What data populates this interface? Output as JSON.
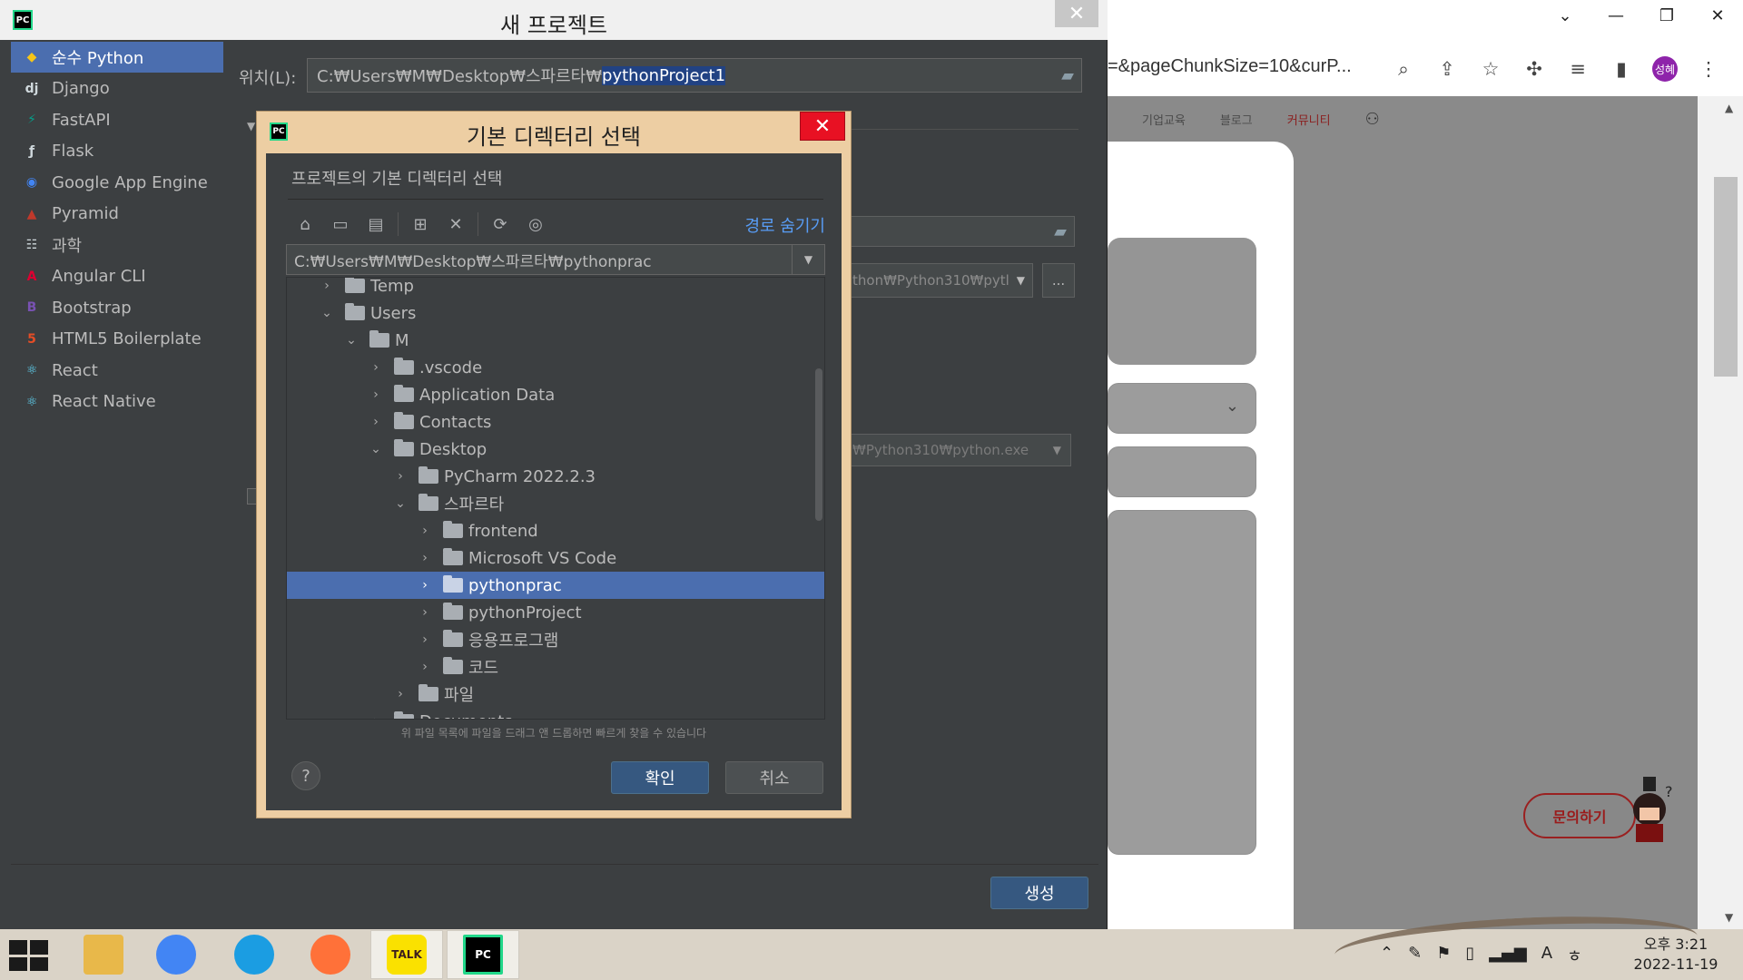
{
  "pycharm": {
    "title": "새 프로젝트",
    "close": "✕",
    "sidebar": [
      {
        "label": "순수 Python",
        "icon": "python-icon",
        "glyph": "◆",
        "color": "#f5c518",
        "selected": true
      },
      {
        "label": "Django",
        "icon": "django-icon",
        "glyph": "dj",
        "color": "#cfd8dc",
        "selected": false
      },
      {
        "label": "FastAPI",
        "icon": "fastapi-icon",
        "glyph": "⚡",
        "color": "#059f8a",
        "selected": false
      },
      {
        "label": "Flask",
        "icon": "flask-icon",
        "glyph": "ƒ",
        "color": "#cfd8dc",
        "selected": false
      },
      {
        "label": "Google App Engine",
        "icon": "google-app-engine-icon",
        "glyph": "◉",
        "color": "#4285f4",
        "selected": false
      },
      {
        "label": "Pyramid",
        "icon": "pyramid-icon",
        "glyph": "▲",
        "color": "#c0392b",
        "selected": false
      },
      {
        "label": "과학",
        "icon": "science-grid-icon",
        "glyph": "☷",
        "color": "#cfd8dc",
        "selected": false
      },
      {
        "label": "Angular CLI",
        "icon": "angular-icon",
        "glyph": "A",
        "color": "#dd0031",
        "selected": false
      },
      {
        "label": "Bootstrap",
        "icon": "bootstrap-icon",
        "glyph": "B",
        "color": "#7952b3",
        "selected": false
      },
      {
        "label": "HTML5 Boilerplate",
        "icon": "html5-icon",
        "glyph": "5",
        "color": "#e44d26",
        "selected": false
      },
      {
        "label": "React",
        "icon": "react-icon",
        "glyph": "⚛",
        "color": "#61dafb",
        "selected": false
      },
      {
        "label": "React Native",
        "icon": "react-native-icon",
        "glyph": "⚛",
        "color": "#61dafb",
        "selected": false
      }
    ],
    "location_label": "위치(L):",
    "location_prefix": "C:₩Users₩M₩Desktop₩스파르타₩",
    "location_selected": "pythonProject1",
    "interpreter_partial": "thon₩Python310₩pytl",
    "base_interpreter_partial": "₩Python310₩python.exe",
    "more_button": "...",
    "create_button": "생성"
  },
  "dialog": {
    "title": "기본 디렉터리 선택",
    "close": "✕",
    "subtitle": "프로젝트의 기본 디렉터리 선택",
    "hide_path": "경로 숨기기",
    "path": "C:₩Users₩M₩Desktop₩스파르타₩pythonprac",
    "tree": [
      {
        "label": "Temp",
        "depth": 0,
        "expanded": false,
        "selected": false
      },
      {
        "label": "Users",
        "depth": 0,
        "expanded": true,
        "selected": false
      },
      {
        "label": "M",
        "depth": 1,
        "expanded": true,
        "selected": false
      },
      {
        "label": ".vscode",
        "depth": 2,
        "expanded": false,
        "selected": false
      },
      {
        "label": "Application Data",
        "depth": 2,
        "expanded": false,
        "selected": false
      },
      {
        "label": "Contacts",
        "depth": 2,
        "expanded": false,
        "selected": false
      },
      {
        "label": "Desktop",
        "depth": 2,
        "expanded": true,
        "selected": false
      },
      {
        "label": "PyCharm 2022.2.3",
        "depth": 3,
        "expanded": false,
        "selected": false
      },
      {
        "label": "스파르타",
        "depth": 3,
        "expanded": true,
        "selected": false
      },
      {
        "label": "frontend",
        "depth": 4,
        "expanded": false,
        "selected": false
      },
      {
        "label": "Microsoft VS Code",
        "depth": 4,
        "expanded": false,
        "selected": false
      },
      {
        "label": "pythonprac",
        "depth": 4,
        "expanded": false,
        "selected": true
      },
      {
        "label": "pythonProject",
        "depth": 4,
        "expanded": false,
        "selected": false
      },
      {
        "label": "응용프로그램",
        "depth": 4,
        "expanded": false,
        "selected": false
      },
      {
        "label": "코드",
        "depth": 4,
        "expanded": false,
        "selected": false
      },
      {
        "label": "파일",
        "depth": 3,
        "expanded": false,
        "selected": false
      },
      {
        "label": "Documents",
        "depth": 2,
        "expanded": false,
        "selected": false
      }
    ],
    "hint": "위 파일 목록에 파일을 드래그 앤 드롭하면 빠르게 찾을 수 있습니다",
    "help": "?",
    "ok": "확인",
    "cancel": "취소"
  },
  "browser": {
    "url_fragment": "=&pageChunkSize=10&curP...",
    "avatar_text": "성혜",
    "nav": [
      "기업교육",
      "블로그",
      "커뮤니티"
    ],
    "inquiry_button": "문의하기"
  },
  "taskbar": {
    "apps": [
      {
        "name": "file-explorer-icon",
        "label": "",
        "color": "#e8b84a"
      },
      {
        "name": "chrome-icon",
        "label": "",
        "color": "#4285f4"
      },
      {
        "name": "edge-icon",
        "label": "",
        "color": "#1b9de2"
      },
      {
        "name": "firefox-icon",
        "label": "",
        "color": "#ff7139"
      },
      {
        "name": "kakaotalk-icon",
        "label": "TALK",
        "color": "#fae100"
      },
      {
        "name": "pycharm-icon",
        "label": "PC",
        "color": "#000000"
      }
    ],
    "time": "오후 3:21",
    "date": "2022-11-19"
  }
}
